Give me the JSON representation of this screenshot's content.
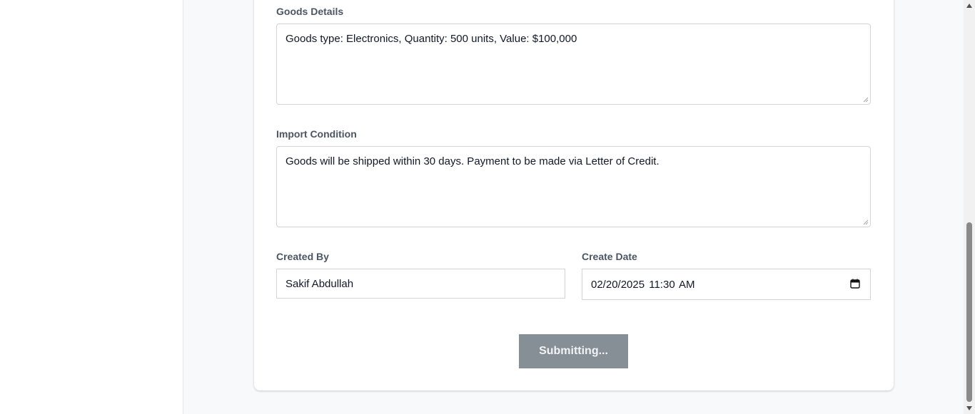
{
  "form": {
    "goods_details": {
      "label": "Goods Details",
      "value": "Goods type: Electronics, Quantity: 500 units, Value: $100,000"
    },
    "import_condition": {
      "label": "Import Condition",
      "value": "Goods will be shipped within 30 days. Payment to be made via Letter of Credit."
    },
    "created_by": {
      "label": "Created By",
      "value": "Sakif Abdullah"
    },
    "create_date": {
      "label": "Create Date",
      "value": "02/20/2025 11:30 AM",
      "icon": "calendar-icon"
    },
    "submit_label": "Submitting..."
  },
  "colors": {
    "button_disabled": "#868e96",
    "page_background": "#f8f9fa",
    "label_text": "#4b5563"
  }
}
